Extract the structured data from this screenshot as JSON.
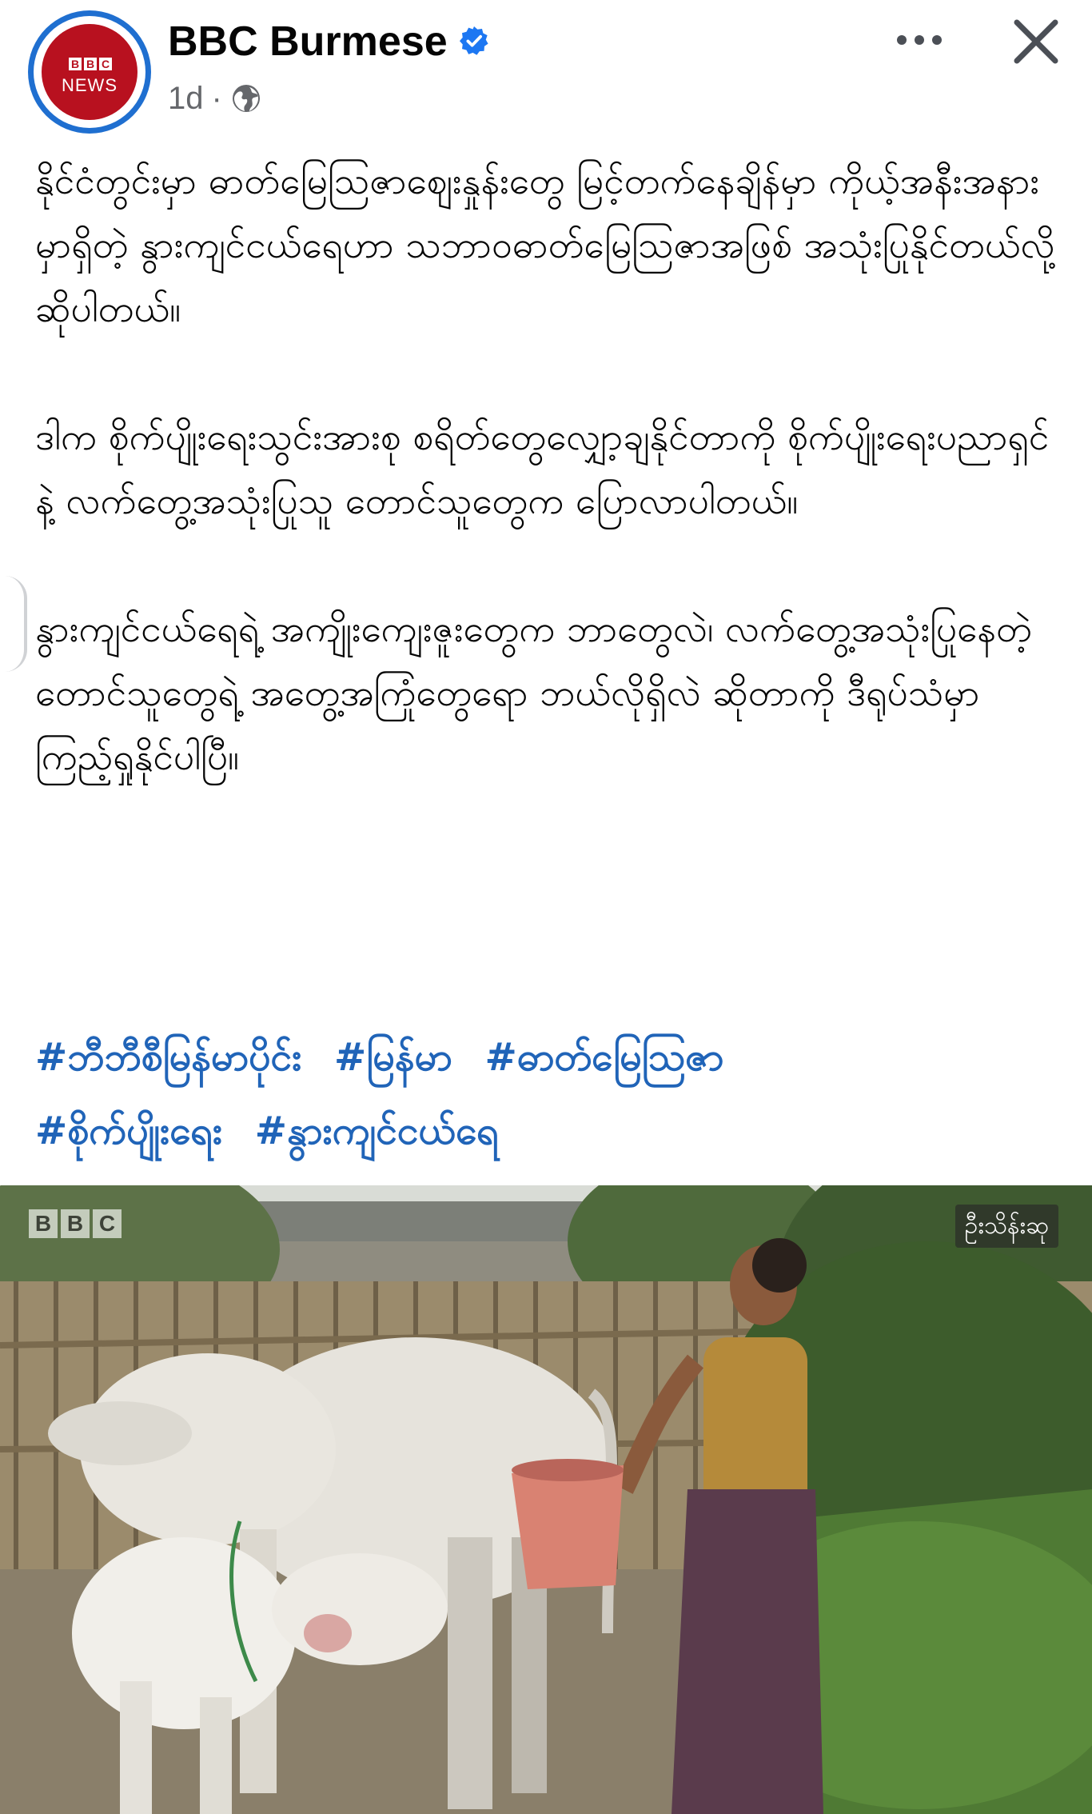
{
  "post": {
    "page_name": "BBC Burmese",
    "time": "1d",
    "separator": "·",
    "avatar_logo_text": "NEWS",
    "paragraphs": [
      "နိုင်ငံတွင်းမှာ ဓာတ်မြေသြဇာဈေးနှုန်းတွေ မြင့်တက်နေချိန်မှာ ကိုယ့်အနီးအနားမှာရှိတဲ့ နွားကျင်ငယ်ရေဟာ သဘာဝဓာတ်မြေသြဇာအဖြစ် အသုံးပြုနိုင်တယ်လို့ ဆိုပါတယ်။",
      "ဒါက စိုက်ပျိုးရေးသွင်းအားစု စရိတ်တွေလျှော့ချနိုင်တာကို စိုက်ပျိုးရေးပညာရှင်နဲ့ လက်တွေ့အသုံးပြုသူ တောင်သူတွေက ပြောလာပါတယ်။",
      "နွားကျင်ငယ်ရေရဲ့ အကျိုးကျေးဇူးတွေက ဘာတွေလဲ၊ လက်တွေ့အသုံးပြုနေတဲ့ တောင်သူတွေရဲ့ အတွေ့အကြုံတွေရော ဘယ်လိုရှိလဲ ဆိုတာကို ဒီရုပ်သံမှာ ကြည့်ရှုနိုင်ပါပြီ။"
    ],
    "hashtags": [
      "#ဘီဘီစီမြန်မာပိုင်း",
      "#မြန်မာ",
      "#ဓာတ်မြေသြဇာ",
      "#စိုက်ပျိုးရေး",
      "#နွားကျင်ငယ်ရေ"
    ]
  },
  "media": {
    "credit": "ဦးသိန်းဆု"
  },
  "icons": {
    "verified": "verified-badge-icon",
    "audience": "globe-icon",
    "more": "more-options-icon",
    "close": "close-icon"
  },
  "colors": {
    "verified_blue": "#1d77f2",
    "hashtag_blue": "#2064b8",
    "bbc_red": "#b8111f",
    "avatar_ring": "#1f6fd0"
  }
}
